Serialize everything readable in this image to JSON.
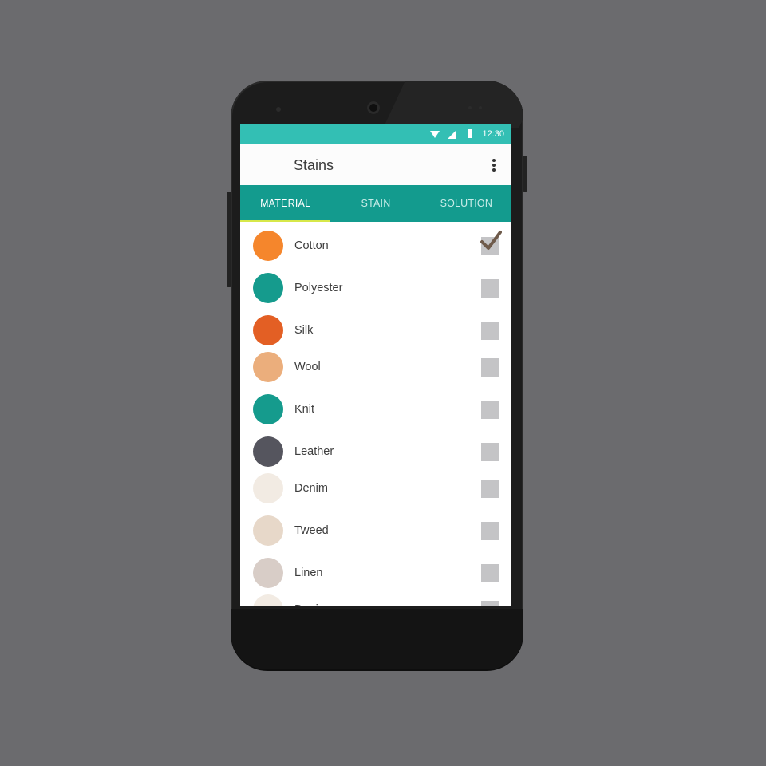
{
  "status_bar": {
    "time": "12:30"
  },
  "app_bar": {
    "title": "Stains"
  },
  "tabs": [
    {
      "label": "MATERIAL",
      "active": true
    },
    {
      "label": "STAIN",
      "active": false
    },
    {
      "label": "SOLUTION",
      "active": false
    }
  ],
  "materials": [
    {
      "name": "Cotton",
      "color": "#f5862c",
      "checked": true
    },
    {
      "name": "Polyester",
      "color": "#159b8d",
      "checked": false
    },
    {
      "name": "Silk",
      "color": "#e35f24",
      "checked": false
    },
    {
      "name": "Wool",
      "color": "#ebae7c",
      "checked": false
    },
    {
      "name": "Knit",
      "color": "#159b8d",
      "checked": false
    },
    {
      "name": "Leather",
      "color": "#55555e",
      "checked": false
    },
    {
      "name": "Denim",
      "color": "#f2ebe3",
      "checked": false
    },
    {
      "name": "Tweed",
      "color": "#e7d8c9",
      "checked": false
    },
    {
      "name": "Linen",
      "color": "#d8cdc7",
      "checked": false
    },
    {
      "name": "Denim",
      "color": "#f2ebe3",
      "checked": false
    }
  ],
  "colors": {
    "status_bar": "#33bfb4",
    "tab_bar": "#139b8e",
    "tab_indicator": "#d7e84a",
    "checkbox": "#c4c4c6",
    "checkmark": "#6f5b4b"
  }
}
